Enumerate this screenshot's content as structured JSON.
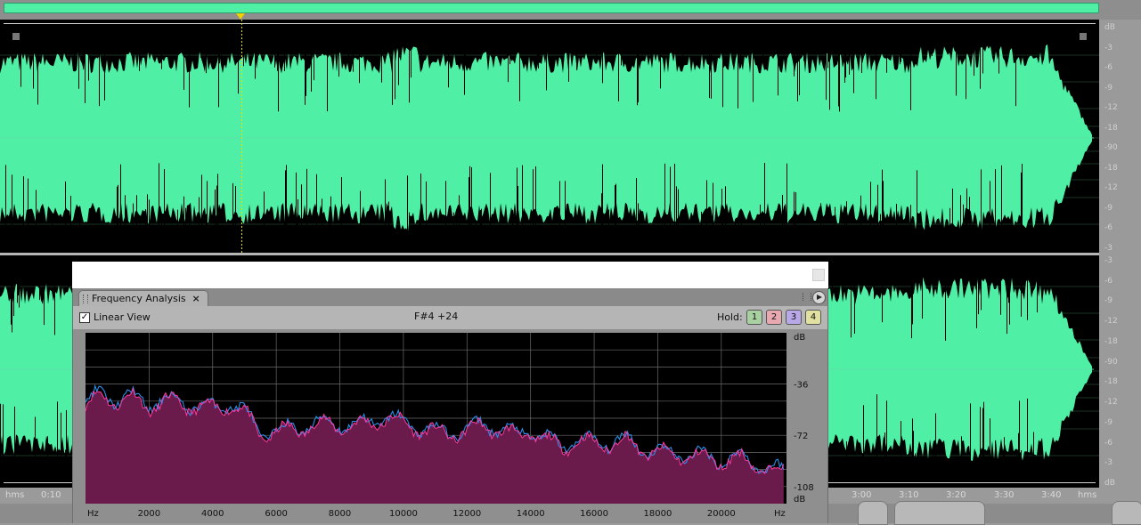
{
  "overview": {
    "marker_position_fraction": 0.217
  },
  "amplitude_scale": {
    "top_channel": [
      "dB",
      "-3",
      "-6",
      "-9",
      "-12",
      "-18",
      "-90",
      "-18",
      "-12",
      "-9",
      "-6",
      "-3"
    ],
    "bottom_channel": [
      "-3",
      "-6",
      "-9",
      "-12",
      "-18",
      "-90",
      "-18",
      "-12",
      "-9",
      "-6",
      "-3",
      "dB"
    ]
  },
  "time_ruler": {
    "unit_left": "hms",
    "unit_right": "hms",
    "visible_left": [
      "0:10"
    ],
    "visible_right": [
      "3:00",
      "3:10",
      "3:20",
      "3:30",
      "3:40"
    ]
  },
  "colors": {
    "waveform": "#4ff0a6",
    "waveform_bg": "#000000",
    "spectrum_fill": "#6b1a4c",
    "spectrum_line_1": "#2a8fe8",
    "spectrum_line_2": "#ff3aa0",
    "hold_1": "#a8d0a0",
    "hold_2": "#e8a8b0",
    "hold_3": "#b8a8e8",
    "hold_4": "#e0e0a0"
  },
  "frequency_analysis": {
    "tab_label": "Frequency Analysis",
    "close_glyph": "×",
    "linear_view_label": "Linear View",
    "linear_view_checked": true,
    "check_glyph": "✓",
    "note_readout": "F#4 +24",
    "hold_label": "Hold:",
    "hold_buttons": [
      "1",
      "2",
      "3",
      "4"
    ]
  },
  "chart_data": {
    "type": "area",
    "x_axis_unit_left": "Hz",
    "x_axis_unit_right": "Hz",
    "x_ticks": [
      2000,
      4000,
      6000,
      8000,
      10000,
      12000,
      14000,
      16000,
      18000,
      20000
    ],
    "xlim": [
      0,
      22050
    ],
    "y_axis_unit_top": "dB",
    "y_axis_unit_bottom": "dB",
    "y_ticks": [
      -36,
      -72,
      -108
    ],
    "ylim": [
      -120,
      0
    ],
    "grid": true,
    "x": [
      0,
      500,
      1000,
      1500,
      2000,
      2500,
      3000,
      3500,
      4000,
      4500,
      5000,
      5500,
      6000,
      6500,
      7000,
      7500,
      8000,
      8500,
      9000,
      9500,
      10000,
      10500,
      11000,
      11500,
      12000,
      12500,
      13000,
      13500,
      14000,
      14500,
      15000,
      15500,
      16000,
      16500,
      17000,
      17500,
      18000,
      18500,
      19000,
      19500,
      20000,
      20500,
      21000,
      21500,
      22000
    ],
    "series": [
      {
        "values": [
          -52,
          -44,
          -48,
          -46,
          -52,
          -48,
          -50,
          -52,
          -54,
          -50,
          -56,
          -71,
          -70,
          -68,
          -66,
          -64,
          -65,
          -66,
          -63,
          -60,
          -64,
          -67,
          -70,
          -71,
          -69,
          -65,
          -68,
          -72,
          -70,
          -76,
          -80,
          -76,
          -78,
          -78,
          -76,
          -82,
          -84,
          -86,
          -86,
          -88,
          -90,
          -88,
          -92,
          -96,
          -98
        ]
      },
      {
        "values": [
          -50,
          -42,
          -47,
          -45,
          -50,
          -47,
          -49,
          -51,
          -53,
          -49,
          -55,
          -70,
          -69,
          -67,
          -65,
          -63,
          -64,
          -65,
          -62,
          -59,
          -63,
          -66,
          -69,
          -70,
          -68,
          -64,
          -67,
          -71,
          -69,
          -75,
          -79,
          -75,
          -77,
          -77,
          -75,
          -81,
          -83,
          -85,
          -85,
          -87,
          -89,
          -87,
          -91,
          -95,
          -97
        ]
      }
    ]
  }
}
